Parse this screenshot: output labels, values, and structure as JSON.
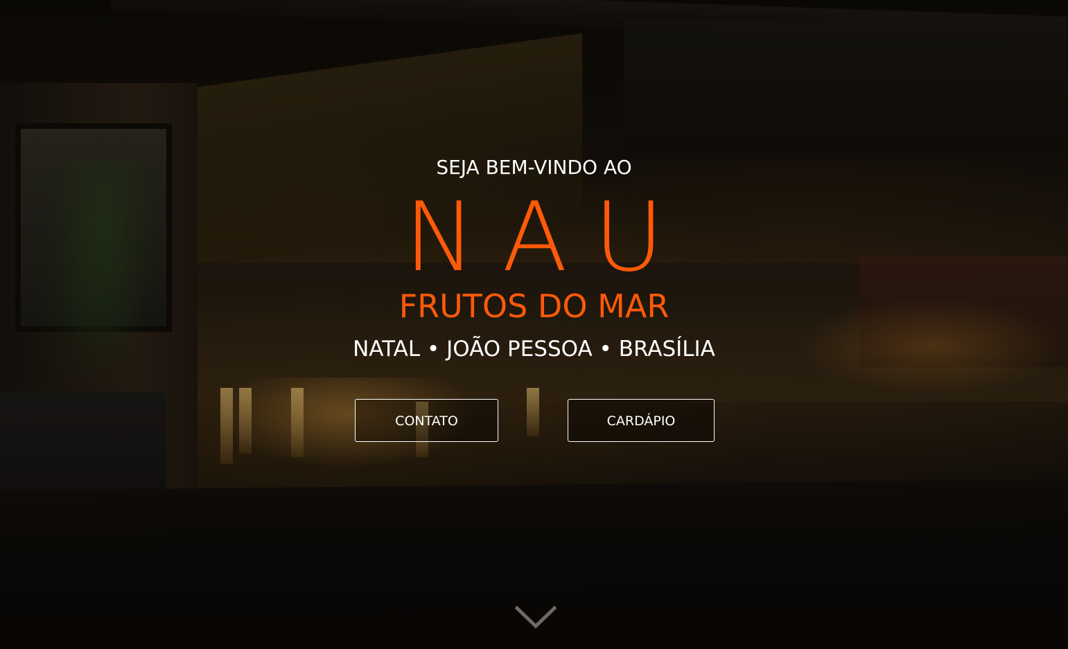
{
  "hero": {
    "welcome": "SEJA BEM-VINDO AO",
    "brand": "NAU",
    "subtitle": "FRUTOS DO MAR",
    "cities": "NATAL • JOÃO PESSOA • BRASÍLIA"
  },
  "buttons": {
    "contact_label": "CONTATO",
    "menu_label": "CARDÁPIO"
  },
  "icons": {
    "scroll_down": "chevron-down-icon"
  },
  "colors": {
    "accent": "#ff5a0a",
    "text": "#ffffff",
    "background": "#0b0805"
  }
}
